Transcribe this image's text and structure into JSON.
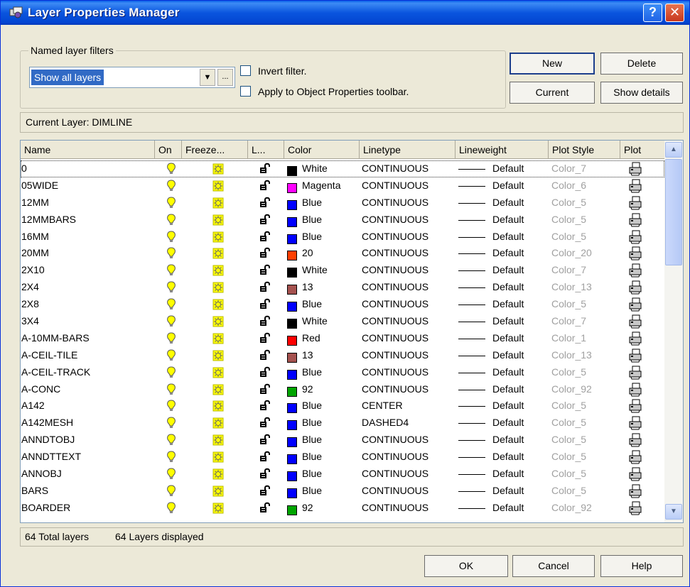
{
  "window": {
    "title": "Layer Properties Manager",
    "help_label": "?",
    "close_label": "✕"
  },
  "filters": {
    "group_label": "Named layer filters",
    "selected": "Show all layers",
    "more_label": "...",
    "invert_label": "Invert filter.",
    "apply_label": "Apply to Object Properties toolbar."
  },
  "buttons": {
    "new": "New",
    "delete": "Delete",
    "current": "Current",
    "show_details": "Show details",
    "ok": "OK",
    "cancel": "Cancel",
    "help": "Help"
  },
  "current_layer": "Current Layer:  DIMLINE",
  "columns": [
    "Name",
    "On",
    "Freeze...",
    "L...",
    "Color",
    "Linetype",
    "Lineweight",
    "Plot Style",
    "Plot"
  ],
  "layers": [
    {
      "name": "0",
      "color": "White",
      "swatch": "#000000",
      "linetype": "CONTINUOUS",
      "lineweight": "Default",
      "plot_style": "Color_7"
    },
    {
      "name": "05WIDE",
      "color": "Magenta",
      "swatch": "#ff00ff",
      "linetype": "CONTINUOUS",
      "lineweight": "Default",
      "plot_style": "Color_6"
    },
    {
      "name": "12MM",
      "color": "Blue",
      "swatch": "#0000ff",
      "linetype": "CONTINUOUS",
      "lineweight": "Default",
      "plot_style": "Color_5"
    },
    {
      "name": "12MMBARS",
      "color": "Blue",
      "swatch": "#0000ff",
      "linetype": "CONTINUOUS",
      "lineweight": "Default",
      "plot_style": "Color_5"
    },
    {
      "name": "16MM",
      "color": "Blue",
      "swatch": "#0000ff",
      "linetype": "CONTINUOUS",
      "lineweight": "Default",
      "plot_style": "Color_5"
    },
    {
      "name": "20MM",
      "color": "20",
      "swatch": "#ff3f00",
      "linetype": "CONTINUOUS",
      "lineweight": "Default",
      "plot_style": "Color_20"
    },
    {
      "name": "2X10",
      "color": "White",
      "swatch": "#000000",
      "linetype": "CONTINUOUS",
      "lineweight": "Default",
      "plot_style": "Color_7"
    },
    {
      "name": "2X4",
      "color": "13",
      "swatch": "#a5524f",
      "linetype": "CONTINUOUS",
      "lineweight": "Default",
      "plot_style": "Color_13"
    },
    {
      "name": "2X8",
      "color": "Blue",
      "swatch": "#0000ff",
      "linetype": "CONTINUOUS",
      "lineweight": "Default",
      "plot_style": "Color_5"
    },
    {
      "name": "3X4",
      "color": "White",
      "swatch": "#000000",
      "linetype": "CONTINUOUS",
      "lineweight": "Default",
      "plot_style": "Color_7"
    },
    {
      "name": "A-10MM-BARS",
      "color": "Red",
      "swatch": "#ff0000",
      "linetype": "CONTINUOUS",
      "lineweight": "Default",
      "plot_style": "Color_1"
    },
    {
      "name": "A-CEIL-TILE",
      "color": "13",
      "swatch": "#a5524f",
      "linetype": "CONTINUOUS",
      "lineweight": "Default",
      "plot_style": "Color_13"
    },
    {
      "name": "A-CEIL-TRACK",
      "color": "Blue",
      "swatch": "#0000ff",
      "linetype": "CONTINUOUS",
      "lineweight": "Default",
      "plot_style": "Color_5"
    },
    {
      "name": "A-CONC",
      "color": "92",
      "swatch": "#00a500",
      "linetype": "CONTINUOUS",
      "lineweight": "Default",
      "plot_style": "Color_92"
    },
    {
      "name": "A142",
      "color": "Blue",
      "swatch": "#0000ff",
      "linetype": "CENTER",
      "lineweight": "Default",
      "plot_style": "Color_5"
    },
    {
      "name": "A142MESH",
      "color": "Blue",
      "swatch": "#0000ff",
      "linetype": "DASHED4",
      "lineweight": "Default",
      "plot_style": "Color_5"
    },
    {
      "name": "ANNDTOBJ",
      "color": "Blue",
      "swatch": "#0000ff",
      "linetype": "CONTINUOUS",
      "lineweight": "Default",
      "plot_style": "Color_5"
    },
    {
      "name": "ANNDTTEXT",
      "color": "Blue",
      "swatch": "#0000ff",
      "linetype": "CONTINUOUS",
      "lineweight": "Default",
      "plot_style": "Color_5"
    },
    {
      "name": "ANNOBJ",
      "color": "Blue",
      "swatch": "#0000ff",
      "linetype": "CONTINUOUS",
      "lineweight": "Default",
      "plot_style": "Color_5"
    },
    {
      "name": "BARS",
      "color": "Blue",
      "swatch": "#0000ff",
      "linetype": "CONTINUOUS",
      "lineweight": "Default",
      "plot_style": "Color_5"
    },
    {
      "name": "BOARDER",
      "color": "92",
      "swatch": "#00a500",
      "linetype": "CONTINUOUS",
      "lineweight": "Default",
      "plot_style": "Color_92"
    }
  ],
  "status": {
    "total": "64 Total layers",
    "displayed": "64 Layers displayed"
  },
  "icons": {
    "on": "lightbulb-icon",
    "freeze": "sun-icon",
    "lock": "padlock-icon",
    "plot": "printer-icon"
  }
}
